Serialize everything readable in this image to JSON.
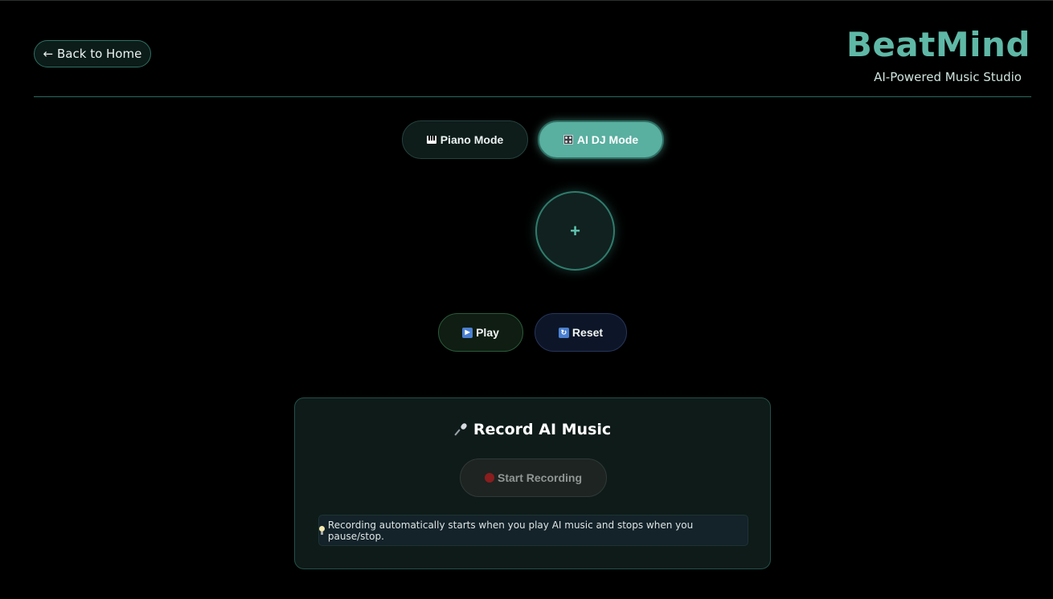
{
  "header": {
    "back_label": "← Back to Home",
    "brand_title": "BeatMind",
    "brand_subtitle": "AI-Powered Music Studio"
  },
  "modes": {
    "piano_label": "Piano Mode",
    "piano_icon": "piano-keys-icon",
    "dj_label": "AI DJ Mode",
    "dj_icon": "mixer-console-icon",
    "active": "AI DJ Mode"
  },
  "add_button": {
    "label": "+"
  },
  "controls": {
    "play_label": "Play",
    "play_icon": "play-icon",
    "reset_label": "Reset",
    "reset_icon": "reset-icon"
  },
  "recording": {
    "title": "Record AI Music",
    "title_icon": "microphone-icon",
    "start_label": "Start Recording",
    "start_icon": "record-dot-icon",
    "hint": "Recording automatically starts when you play AI music and stops when you pause/stop.",
    "hint_icon": "lightbulb-icon"
  },
  "colors": {
    "accent": "#5fb8a6",
    "background": "#000000",
    "active_mode": "#59afa0"
  }
}
